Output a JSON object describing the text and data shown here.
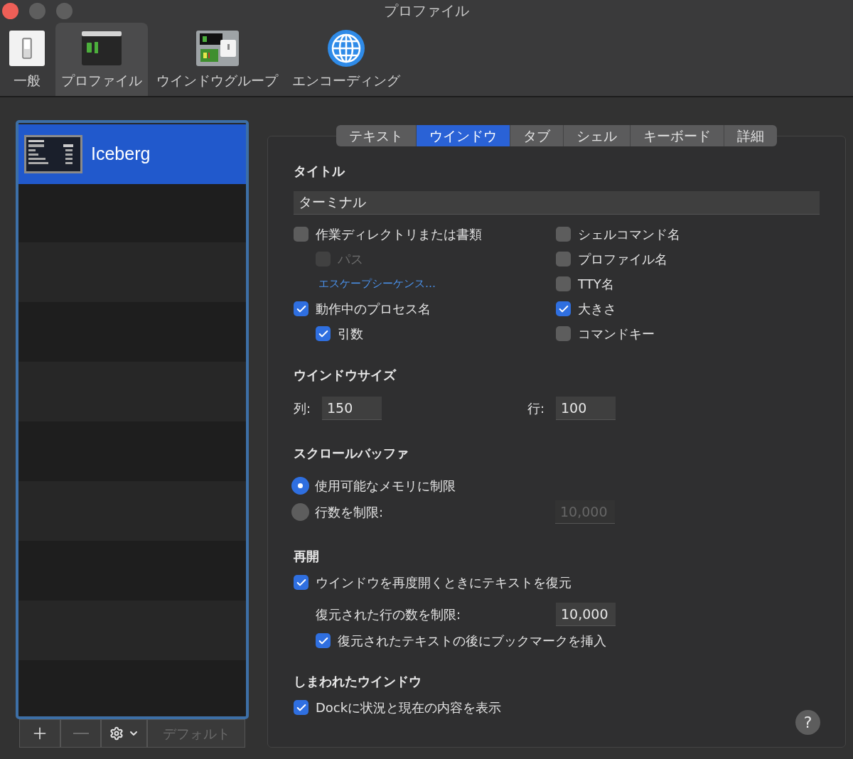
{
  "window": {
    "title": "プロファイル"
  },
  "toolbar": [
    {
      "kind": "general",
      "label": "一般",
      "selected": false
    },
    {
      "kind": "profiles",
      "label": "プロファイル",
      "selected": true
    },
    {
      "kind": "groups",
      "label": "ウインドウグループ",
      "selected": false
    },
    {
      "kind": "encoding",
      "label": "エンコーディング",
      "selected": false
    }
  ],
  "profiles": {
    "items": [
      {
        "name": "Iceberg",
        "selected": true
      }
    ],
    "buttons": [
      {
        "kind": "add",
        "disabled": false
      },
      {
        "kind": "remove",
        "disabled": true
      },
      {
        "kind": "action",
        "disabled": false
      },
      {
        "kind": "text",
        "label": "デフォルト",
        "disabled": true
      }
    ]
  },
  "tabs": [
    {
      "label": "テキスト",
      "selected": false
    },
    {
      "label": "ウインドウ",
      "selected": true
    },
    {
      "label": "タブ",
      "selected": false
    },
    {
      "label": "シェル",
      "selected": false
    },
    {
      "label": "キーボード",
      "selected": false
    },
    {
      "label": "詳細",
      "selected": false
    }
  ],
  "title_section": {
    "heading": "タイトル",
    "value": "ターミナル",
    "left_options": [
      {
        "kind": "checkbox",
        "label": "作業ディレクトリまたは書類",
        "checked": false,
        "disabled": false,
        "children": [
          {
            "kind": "checkbox",
            "label": "パス",
            "checked": false,
            "disabled": true
          },
          {
            "kind": "link",
            "label": "エスケープシーケンス…"
          }
        ]
      },
      {
        "kind": "checkbox",
        "label": "動作中のプロセス名",
        "checked": true,
        "disabled": false,
        "children": [
          {
            "kind": "checkbox",
            "label": "引数",
            "checked": true,
            "disabled": false
          }
        ]
      }
    ],
    "right_options": [
      {
        "kind": "checkbox",
        "label": "シェルコマンド名",
        "checked": false,
        "disabled": false
      },
      {
        "kind": "checkbox",
        "label": "プロファイル名",
        "checked": false,
        "disabled": false
      },
      {
        "kind": "checkbox",
        "label": "TTY名",
        "checked": false,
        "disabled": false
      },
      {
        "kind": "checkbox",
        "label": "大きさ",
        "checked": true,
        "disabled": false
      },
      {
        "kind": "checkbox",
        "label": "コマンドキー",
        "checked": false,
        "disabled": false
      }
    ]
  },
  "size_section": {
    "heading": "ウインドウサイズ",
    "columns": {
      "label": "列:",
      "value": "150"
    },
    "rows": {
      "label": "行:",
      "value": "100"
    }
  },
  "scrollback_section": {
    "heading": "スクロールバッファ",
    "options": [
      {
        "label": "使用可能なメモリに制限",
        "selected": true
      },
      {
        "label": "行数を制限:",
        "selected": false,
        "field": {
          "value": "10,000",
          "disabled": true
        }
      }
    ]
  },
  "restore_section": {
    "heading": "再開",
    "option": {
      "label": "ウインドウを再度開くときにテキストを復元",
      "checked": true,
      "disabled": false
    },
    "limit": {
      "label": "復元された行の数を制限:",
      "value": "10,000"
    },
    "bookmark": {
      "label": "復元されたテキストの後にブックマークを挿入",
      "checked": true,
      "disabled": false
    }
  },
  "minimized_section": {
    "heading": "しまわれたウインドウ",
    "option": {
      "label": "Dockに状況と現在の内容を表示",
      "checked": true,
      "disabled": false
    }
  },
  "help_button": {
    "label": "?"
  }
}
